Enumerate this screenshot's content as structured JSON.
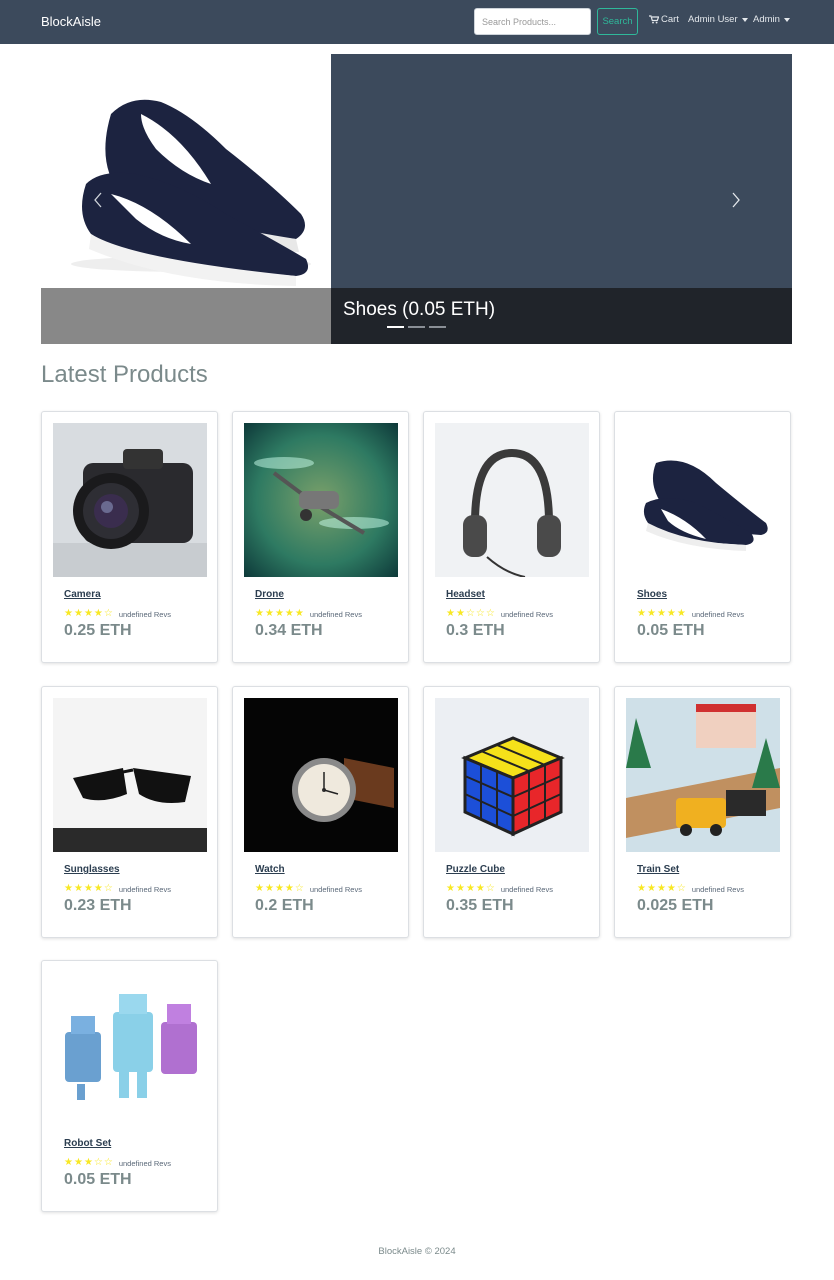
{
  "navbar": {
    "brand": "BlockAisle",
    "search_placeholder": "Search Products...",
    "search_button": "Search",
    "cart_label": "Cart",
    "user_menu": "Admin User",
    "admin_menu": "Admin"
  },
  "carousel": {
    "caption": "Shoes (0.05 ETH)",
    "slide_count": 3,
    "active_index": 0
  },
  "section_title": "Latest Products",
  "products": [
    {
      "name": "Camera",
      "rating": 4,
      "reviews": "undefined Revs",
      "price": "0.25 ETH",
      "image": "camera"
    },
    {
      "name": "Drone",
      "rating": 5,
      "reviews": "undefined Revs",
      "price": "0.34 ETH",
      "image": "drone"
    },
    {
      "name": "Headset",
      "rating": 2,
      "reviews": "undefined Revs",
      "price": "0.3 ETH",
      "image": "headset"
    },
    {
      "name": "Shoes",
      "rating": 5,
      "reviews": "undefined Revs",
      "price": "0.05 ETH",
      "image": "shoes"
    },
    {
      "name": "Sunglasses",
      "rating": 4,
      "reviews": "undefined Revs",
      "price": "0.23 ETH",
      "image": "sunglasses"
    },
    {
      "name": "Watch",
      "rating": 4,
      "reviews": "undefined Revs",
      "price": "0.2 ETH",
      "image": "watch"
    },
    {
      "name": "Puzzle Cube",
      "rating": 4,
      "reviews": "undefined Revs",
      "price": "0.35 ETH",
      "image": "cube"
    },
    {
      "name": "Train Set",
      "rating": 4,
      "reviews": "undefined Revs",
      "price": "0.025 ETH",
      "image": "train"
    },
    {
      "name": "Robot Set",
      "rating": 3,
      "reviews": "undefined Revs",
      "price": "0.05 ETH",
      "image": "robot"
    }
  ],
  "footer": "BlockAisle © 2024",
  "colors": {
    "navbar": "#3c4a5c",
    "accent": "#2fb89a",
    "star": "#f8e825",
    "text": "#7b8a8b"
  }
}
